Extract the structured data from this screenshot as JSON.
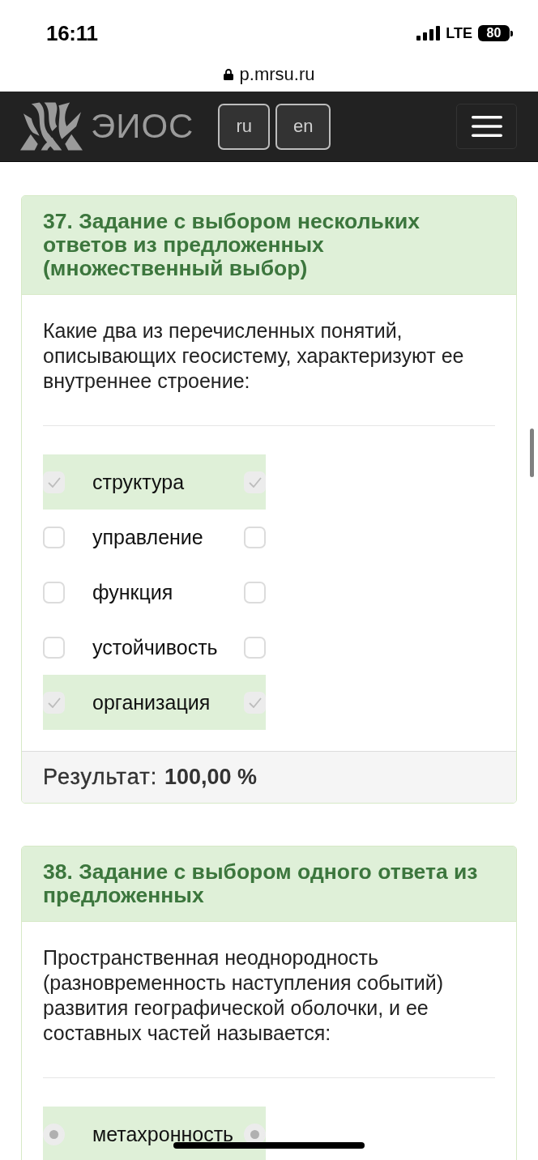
{
  "status_bar": {
    "time": "16:11",
    "network": "LTE",
    "battery": "80"
  },
  "address_bar": {
    "url": "p.mrsu.ru"
  },
  "header": {
    "logo_text": "ЭИОС",
    "languages": [
      {
        "label": "ru"
      },
      {
        "label": "en"
      }
    ]
  },
  "questions": [
    {
      "title": "37. Задание с выбором нескольких ответов из предложенных (множественный выбор)",
      "kind": "multiple",
      "text": "Какие два из перечисленных понятий, описывающих геосистему, характеризуют ее внутреннее строение:",
      "options": [
        {
          "label": "структура",
          "selected": true,
          "correct": true
        },
        {
          "label": "управление",
          "selected": false,
          "correct": false
        },
        {
          "label": "функция",
          "selected": false,
          "correct": false
        },
        {
          "label": "устойчивость",
          "selected": false,
          "correct": false
        },
        {
          "label": "организация",
          "selected": true,
          "correct": true
        }
      ],
      "result": "Результат: **100,00 %**"
    },
    {
      "title": "38. Задание с выбором одного ответа из предложенных",
      "kind": "single",
      "text": "Пространственная неоднородность (разновременность наступления событий) развития географической оболочки, и ее составных частей называется:",
      "options": [
        {
          "label": "метахронность",
          "selected": true,
          "correct": true
        }
      ]
    }
  ]
}
